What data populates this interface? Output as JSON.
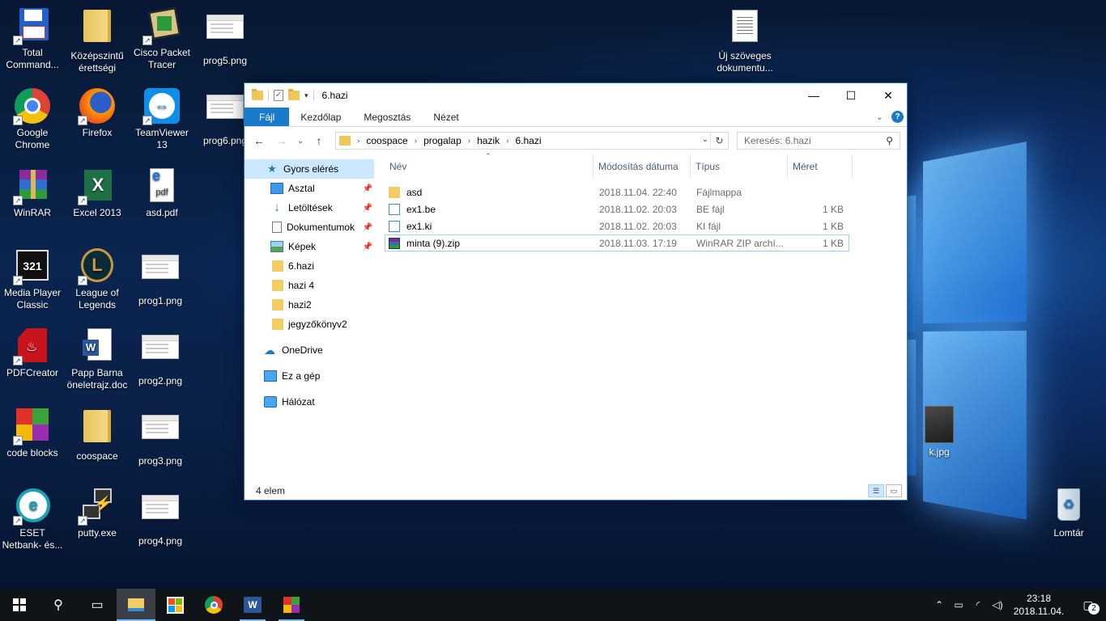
{
  "desktop": {
    "icons": [
      {
        "label": "Total\nCommand...",
        "icon": "total-commander-floppy-icon"
      },
      {
        "label": "Középszintű\nérettségi",
        "icon": "folder-icon"
      },
      {
        "label": "Cisco Packet\nTracer",
        "icon": "cisco-packet-tracer-icon"
      },
      {
        "label": "prog5.png",
        "icon": "png-file-icon"
      },
      {
        "label": "Google\nChrome",
        "icon": "chrome-icon"
      },
      {
        "label": "Firefox",
        "icon": "firefox-icon"
      },
      {
        "label": "TeamViewer\n13",
        "icon": "teamviewer-icon"
      },
      {
        "label": "prog6.png",
        "icon": "png-file-icon"
      },
      {
        "label": "WinRAR",
        "icon": "winrar-icon"
      },
      {
        "label": "Excel 2013",
        "icon": "excel-icon"
      },
      {
        "label": "asd.pdf",
        "icon": "pdf-file-icon"
      },
      {
        "label": "Media Player\nClassic",
        "icon": "media-player-classic-icon"
      },
      {
        "label": "League of\nLegends",
        "icon": "league-of-legends-icon"
      },
      {
        "label": "prog1.png",
        "icon": "png-file-icon"
      },
      {
        "label": "PDFCreator",
        "icon": "pdfcreator-icon"
      },
      {
        "label": "Papp Barna\nöneletrajz.doc",
        "icon": "word-doc-icon"
      },
      {
        "label": "prog2.png",
        "icon": "png-file-icon"
      },
      {
        "label": "code blocks",
        "icon": "codeblocks-icon"
      },
      {
        "label": "coospace",
        "icon": "folder-icon"
      },
      {
        "label": "prog3.png",
        "icon": "png-file-icon"
      },
      {
        "label": "ESET\nNetbank- és...",
        "icon": "eset-icon"
      },
      {
        "label": "putty.exe",
        "icon": "putty-icon"
      },
      {
        "label": "prog4.png",
        "icon": "png-file-icon"
      },
      {
        "label": "Új szöveges\ndokumentu...",
        "icon": "text-document-icon"
      },
      {
        "label": "k.jpg",
        "icon": "jpg-file-icon"
      },
      {
        "label": "Lomtár",
        "icon": "recycle-bin-icon"
      }
    ]
  },
  "explorer": {
    "title": "6.hazi",
    "controls": {
      "minimize": "—",
      "maximize": "☐",
      "close": "✕"
    },
    "ribbon_tabs": [
      "Fájl",
      "Kezdőlap",
      "Megosztás",
      "Nézet"
    ],
    "help": "?",
    "breadcrumb": [
      "coospace",
      "progalap",
      "hazik",
      "6.hazi"
    ],
    "search_placeholder": "Keresés: 6.hazi",
    "nav": {
      "quick_access": "Gyors elérés",
      "pinned": [
        "Asztal",
        "Letöltések",
        "Dokumentumok",
        "Képek"
      ],
      "recent": [
        "6.hazi",
        "hazi 4",
        "hazi2",
        "jegyzőkönyv2"
      ],
      "onedrive": "OneDrive",
      "this_pc": "Ez a gép",
      "network": "Hálózat"
    },
    "columns": {
      "name": "Név",
      "date": "Módosítás dátuma",
      "type": "Típus",
      "size": "Méret"
    },
    "files": [
      {
        "name": "asd",
        "date": "2018.11.04. 22:40",
        "type": "Fájlmappa",
        "size": "",
        "kind": "folder"
      },
      {
        "name": "ex1.be",
        "date": "2018.11.02. 20:03",
        "type": "BE fájl",
        "size": "1 KB",
        "kind": "file"
      },
      {
        "name": "ex1.ki",
        "date": "2018.11.02. 20:03",
        "type": "KI fájl",
        "size": "1 KB",
        "kind": "file"
      },
      {
        "name": "minta (9).zip",
        "date": "2018.11.03. 17:19",
        "type": "WinRAR ZIP archí...",
        "size": "1 KB",
        "kind": "zip"
      }
    ],
    "status": "4 elem"
  },
  "taskbar": {
    "time": "23:18",
    "date": "2018.11.04.",
    "notification_count": "2"
  }
}
